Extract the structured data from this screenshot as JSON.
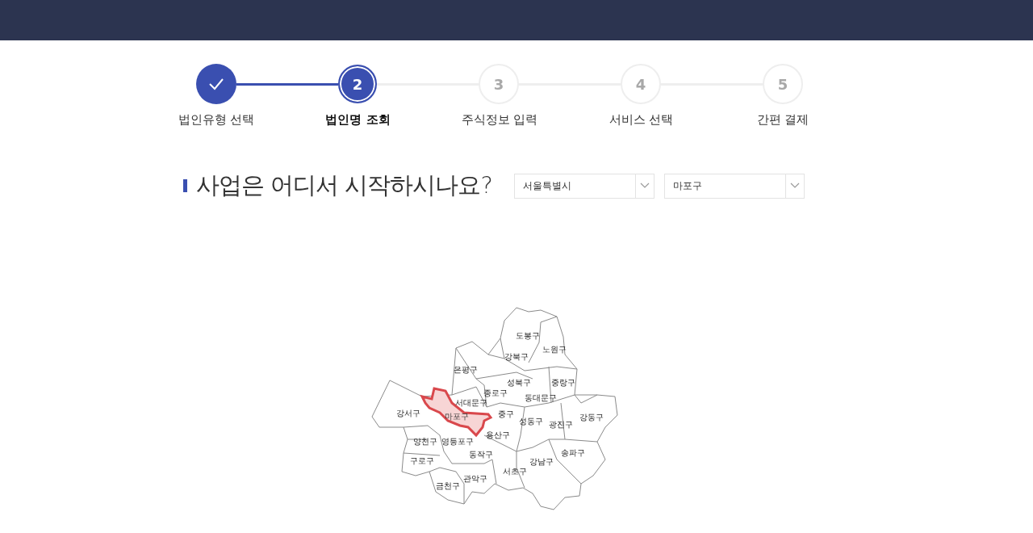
{
  "steps": [
    {
      "label": "법인유형 선택",
      "completed": true,
      "selected": false
    },
    {
      "number": "2",
      "label": "법인명 조회",
      "completed": false,
      "selected": true
    },
    {
      "number": "3",
      "label": "주식정보 입력",
      "completed": false,
      "selected": false
    },
    {
      "number": "4",
      "label": "서비스 선택",
      "completed": false,
      "selected": false
    },
    {
      "number": "5",
      "label": "간편 결제",
      "completed": false,
      "selected": false
    }
  ],
  "question": {
    "title": "사업은 어디서 시작하시나요?"
  },
  "dropdowns": [
    {
      "value": "서울특별시"
    },
    {
      "value": "마포구"
    }
  ],
  "map": {
    "districts": [
      {
        "name": "도봉구",
        "selected": false
      },
      {
        "name": "노원구",
        "selected": false
      },
      {
        "name": "강북구",
        "selected": false
      },
      {
        "name": "은평구",
        "selected": false
      },
      {
        "name": "성북구",
        "selected": false
      },
      {
        "name": "중랑구",
        "selected": false
      },
      {
        "name": "종로구",
        "selected": false
      },
      {
        "name": "동대문구",
        "selected": false
      },
      {
        "name": "서대문구",
        "selected": false
      },
      {
        "name": "강서구",
        "selected": false
      },
      {
        "name": "마포구",
        "selected": true
      },
      {
        "name": "중구",
        "selected": false
      },
      {
        "name": "성동구",
        "selected": false
      },
      {
        "name": "광진구",
        "selected": false
      },
      {
        "name": "강동구",
        "selected": false
      },
      {
        "name": "용산구",
        "selected": false
      },
      {
        "name": "양천구",
        "selected": false
      },
      {
        "name": "영등포구",
        "selected": false
      },
      {
        "name": "동작구",
        "selected": false
      },
      {
        "name": "송파구",
        "selected": false
      },
      {
        "name": "강남구",
        "selected": false
      },
      {
        "name": "구로구",
        "selected": false
      },
      {
        "name": "서초구",
        "selected": false
      },
      {
        "name": "관악구",
        "selected": false
      },
      {
        "name": "금천구",
        "selected": false
      }
    ]
  }
}
